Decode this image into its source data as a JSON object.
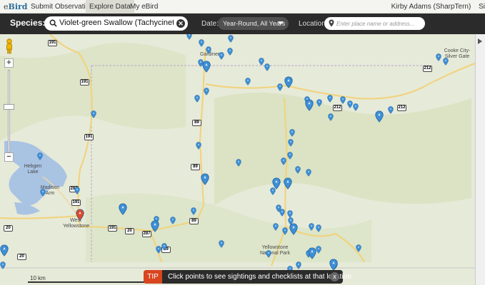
{
  "nav": {
    "logo_e": "e",
    "logo_bird": "Bird",
    "items": [
      "Submit Observations",
      "Explore Data",
      "My eBird"
    ],
    "active_index": 1,
    "user": "Kirby Adams (SharpTern)",
    "user_extra": "Si"
  },
  "search": {
    "species_label": "Species:",
    "species_value": "Violet-green Swallow (Tachycineta thalassina)",
    "date_label": "Date:",
    "date_value": "Year-Round, All Years",
    "location_label": "Location:",
    "location_placeholder": "Enter place name or address..."
  },
  "map": {
    "places": [
      "Gardiner",
      "Hebgen Lake",
      "Madison Arm",
      "West Yellowstone",
      "Yellowstone National Park",
      "Cooke City-Silver Gate"
    ],
    "scale_label": "10 km",
    "routes": [
      "191",
      "191",
      "191",
      "191",
      "89",
      "89",
      "89",
      "287",
      "191",
      "20",
      "287",
      "20",
      "89",
      "212",
      "212",
      "212",
      "20"
    ],
    "pin_color": "#3d8fd6",
    "hotspot_pin_color": "#3d8fd6",
    "selected_pin_color": "#e0472b"
  },
  "tip": {
    "tag": "TIP",
    "message": "Click points to see sightings and checklists at that location",
    "close": "x"
  }
}
